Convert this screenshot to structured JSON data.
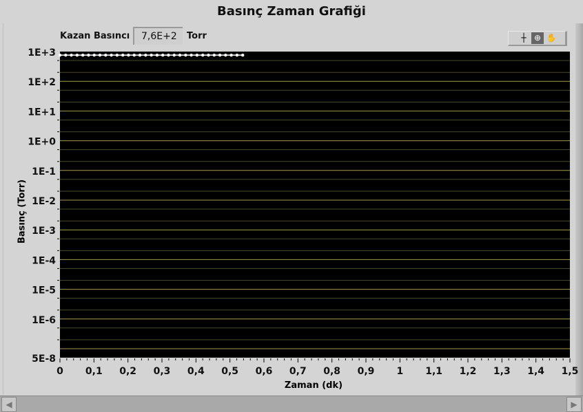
{
  "title": "Basınç Zaman Grafiği",
  "indicator": {
    "label": "Kazan Basıncı",
    "value": "7,6E+2",
    "unit": "Torr"
  },
  "palette": {
    "icons": [
      "cursor-crosshair-icon",
      "zoom-icon",
      "pan-hand-icon"
    ]
  },
  "colors": {
    "plot_bg": "#000000",
    "major_grid": "#a39a4a",
    "minor_grid": "#4a4a2a",
    "trace": "#ffffff"
  },
  "chart_data": {
    "type": "scatter",
    "title": "Basınç Zaman Grafiği",
    "xlabel": "Zaman (dk)",
    "ylabel": "Basınç (Torr)",
    "xlim": [
      0,
      1.5
    ],
    "ylim": [
      5e-08,
      1000
    ],
    "yscale": "log",
    "grid": true,
    "x_ticks": [
      "0",
      "0,1",
      "0,2",
      "0,3",
      "0,4",
      "0,5",
      "0,6",
      "0,7",
      "0,8",
      "0,9",
      "1",
      "1,1",
      "1,2",
      "1,3",
      "1,4",
      "1,5"
    ],
    "y_ticks": [
      "1E+3",
      "1E+2",
      "1E+1",
      "1E+0",
      "1E-1",
      "1E-2",
      "1E-3",
      "1E-4",
      "1E-5",
      "1E-6",
      "5E-8"
    ],
    "series": [
      {
        "name": "Kazan Basıncı",
        "x_start": 0,
        "x_step": 0.0168,
        "count": 33,
        "y": 760
      }
    ]
  }
}
